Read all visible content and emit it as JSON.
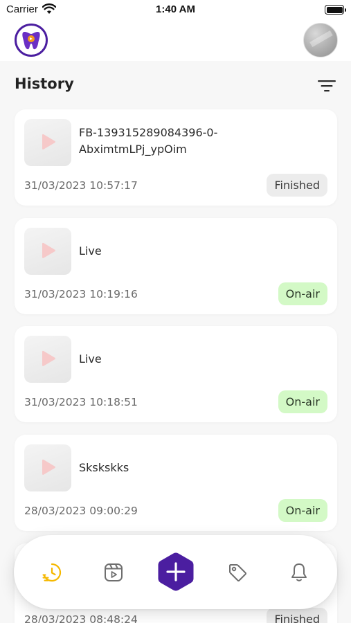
{
  "status_bar": {
    "carrier": "Carrier",
    "time": "1:40 AM"
  },
  "header": {
    "title": "History",
    "logo_icon": "app-logo-icon",
    "avatar_icon": "avatar",
    "filter_icon": "filter-icon"
  },
  "history": [
    {
      "title": "FB-139315289084396-0-AbximtmLPj_ypOim",
      "timestamp": "31/03/2023 10:57:17",
      "status": "Finished"
    },
    {
      "title": "Live",
      "timestamp": "31/03/2023 10:19:16",
      "status": "On-air"
    },
    {
      "title": "Live",
      "timestamp": "31/03/2023 10:18:51",
      "status": "On-air"
    },
    {
      "title": "Skskskks",
      "timestamp": "28/03/2023 09:00:29",
      "status": "On-air"
    },
    {
      "title": "",
      "timestamp": "28/03/2023 08:48:24",
      "status": "Finished"
    }
  ],
  "bottom_nav": {
    "items": [
      "history-icon",
      "video-icon",
      "add-icon",
      "tag-icon",
      "bell-icon"
    ]
  },
  "colors": {
    "accent": "#4b1ea0",
    "active_nav": "#f5b800",
    "onair_bg": "#d3f9c6",
    "finished_bg": "#ececec",
    "play_icon": "#f6c9c9"
  }
}
